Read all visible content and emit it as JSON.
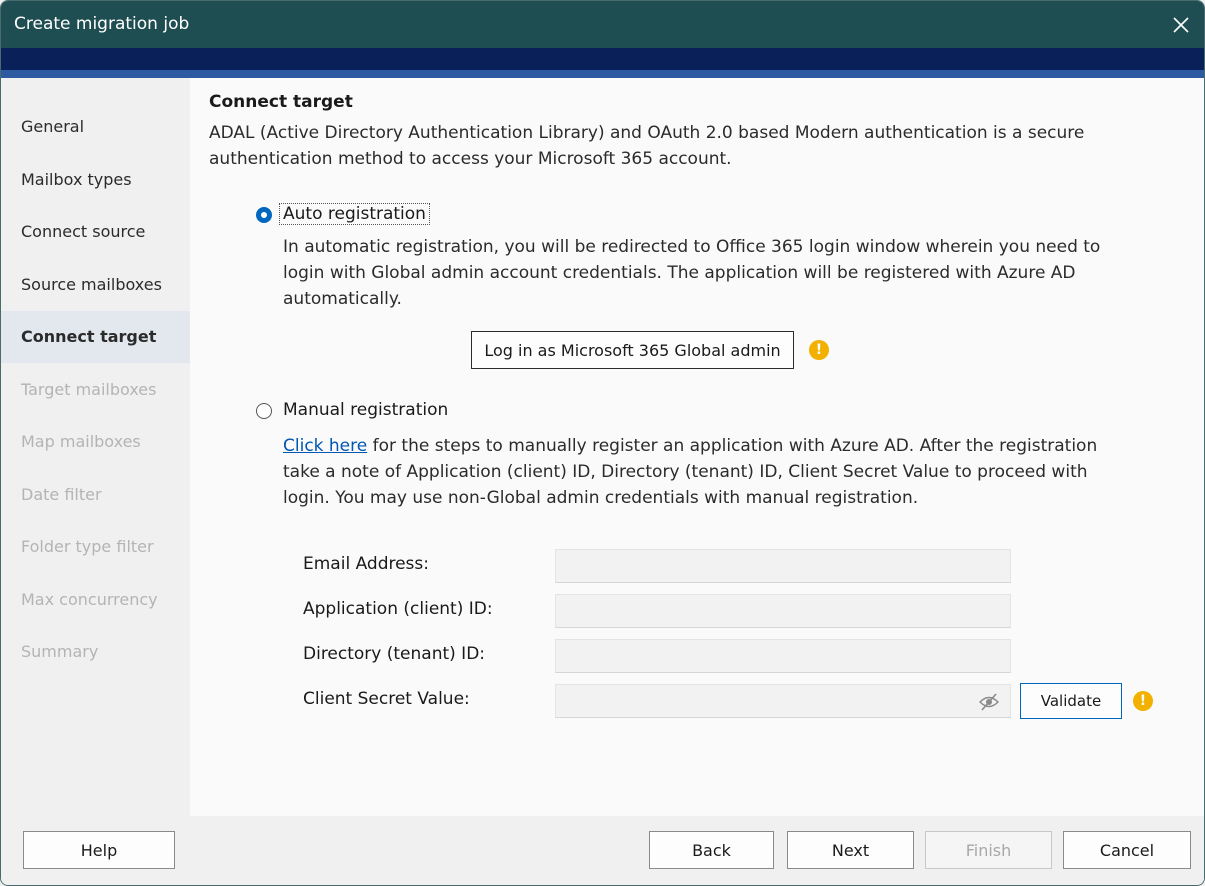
{
  "window": {
    "title": "Create migration job"
  },
  "sidebar": {
    "items": [
      {
        "label": "General",
        "state": "normal"
      },
      {
        "label": "Mailbox types",
        "state": "normal"
      },
      {
        "label": "Connect source",
        "state": "normal"
      },
      {
        "label": "Source mailboxes",
        "state": "normal"
      },
      {
        "label": "Connect target",
        "state": "active"
      },
      {
        "label": "Target mailboxes",
        "state": "disabled"
      },
      {
        "label": "Map mailboxes",
        "state": "disabled"
      },
      {
        "label": "Date filter",
        "state": "disabled"
      },
      {
        "label": "Folder type filter",
        "state": "disabled"
      },
      {
        "label": "Max concurrency",
        "state": "disabled"
      },
      {
        "label": "Summary",
        "state": "disabled"
      }
    ]
  },
  "main": {
    "heading": "Connect target",
    "description": "ADAL (Active Directory Authentication Library) and OAuth 2.0 based Modern authentication is a secure authentication method to access your Microsoft 365 account.",
    "auto": {
      "label": "Auto registration",
      "selected": true,
      "text": "In automatic registration, you will be redirected to Office 365 login window wherein you need to login with Global admin account credentials. The application will be registered with Azure AD automatically.",
      "login_button": "Log in as Microsoft 365 Global admin"
    },
    "manual": {
      "label": "Manual registration",
      "selected": false,
      "link": "Click here",
      "text": " for the steps to manually register an application with Azure AD. After the registration take a note of Application (client) ID, Directory (tenant) ID, Client Secret Value to proceed with login. You may use non-Global admin credentials with manual registration."
    },
    "fields": {
      "email_label": "Email Address:",
      "email_value": "",
      "client_label": "Application (client) ID:",
      "client_value": "",
      "tenant_label": "Directory (tenant) ID:",
      "tenant_value": "",
      "secret_label": "Client Secret Value:",
      "secret_value": ""
    },
    "validate_button": "Validate",
    "warning_glyph": "!"
  },
  "footer": {
    "help": "Help",
    "back": "Back",
    "next": "Next",
    "finish": "Finish",
    "cancel": "Cancel"
  },
  "colors": {
    "titlebar": "#1f4e52",
    "band_dark": "#0a2058",
    "band_mid": "#2d5aa0",
    "accent": "#0067c0",
    "warning": "#f2b000"
  }
}
